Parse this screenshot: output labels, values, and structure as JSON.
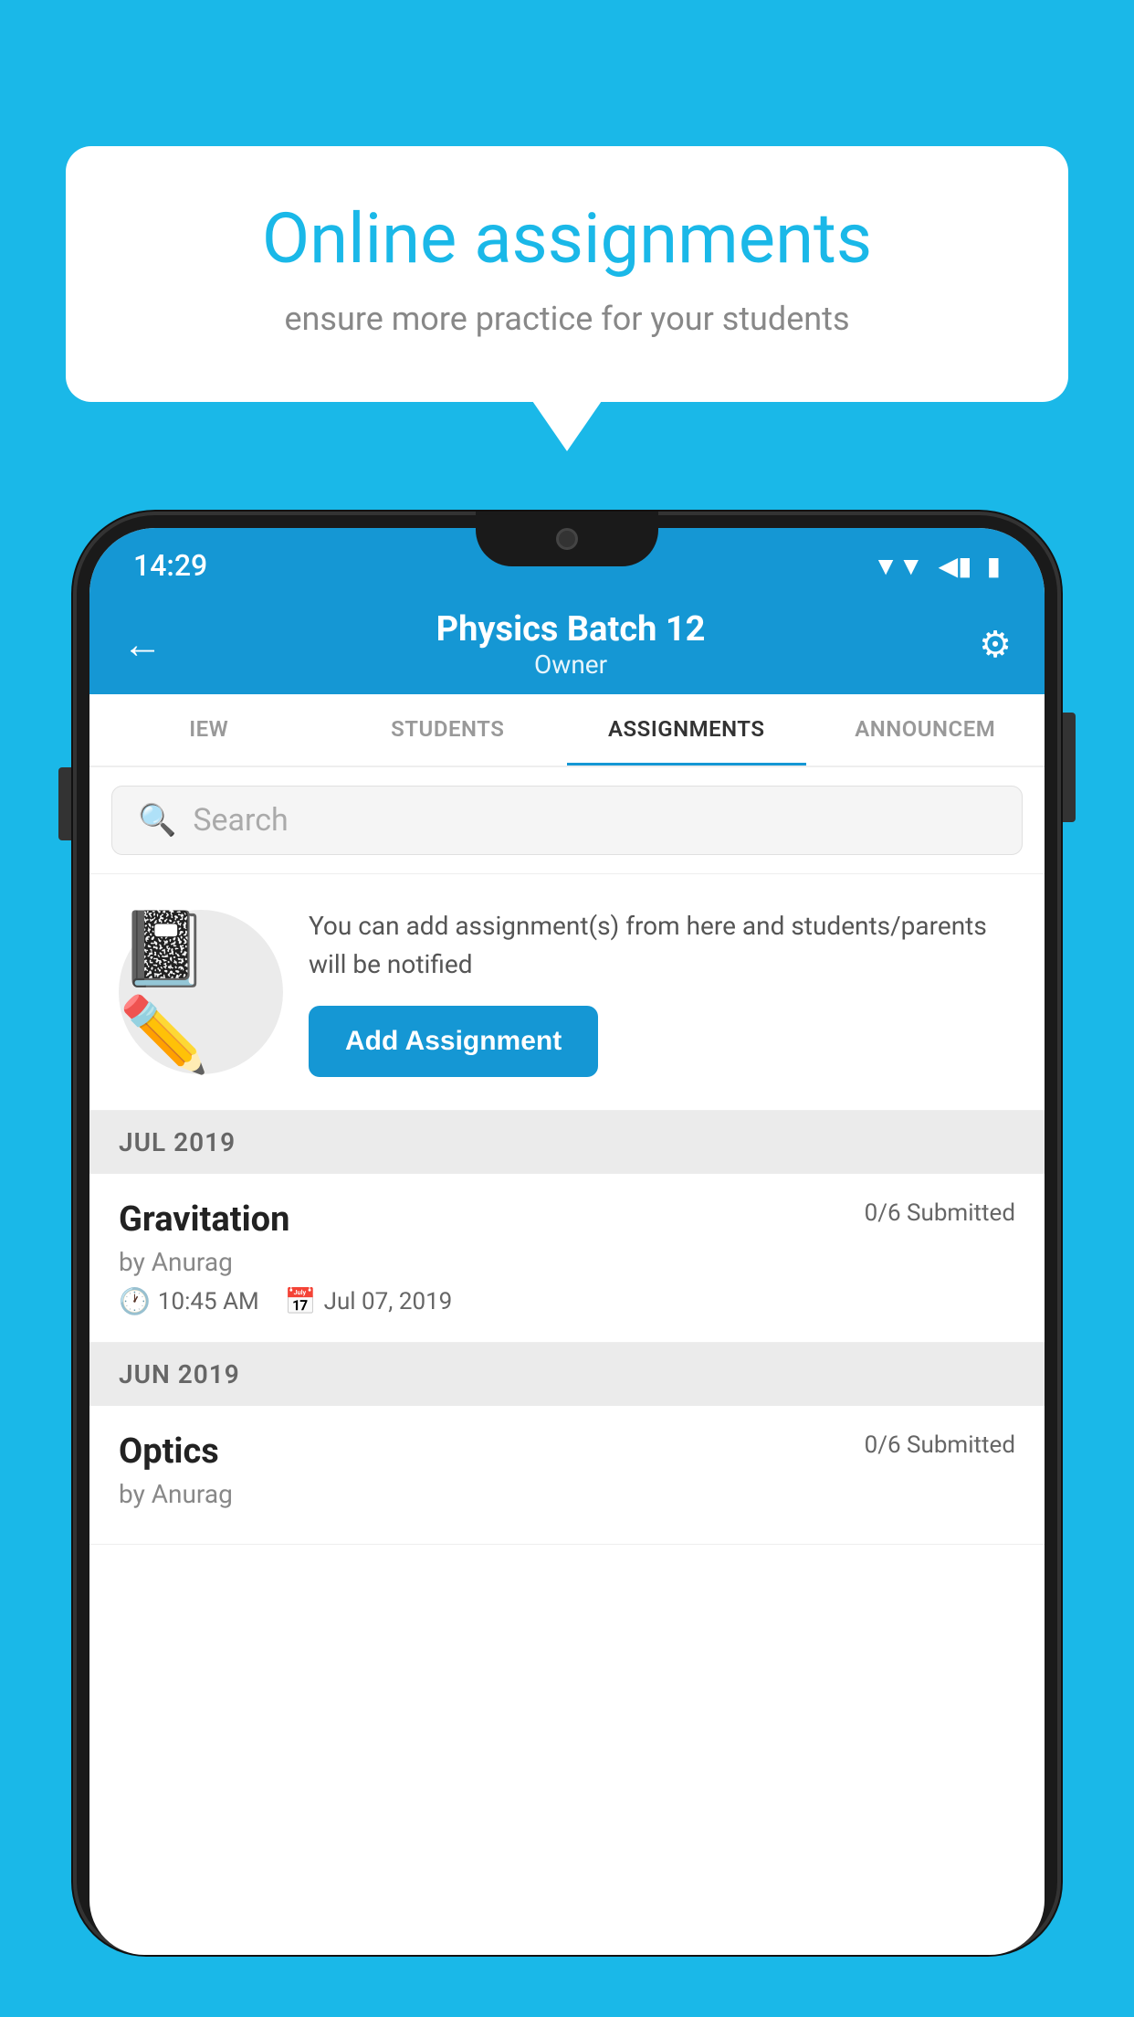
{
  "background": {
    "color": "#1ab8e8"
  },
  "speech_bubble": {
    "title": "Online assignments",
    "subtitle": "ensure more practice for your students"
  },
  "status_bar": {
    "time": "14:29",
    "wifi_icon": "▼",
    "signal_icon": "◀",
    "battery_icon": "▮"
  },
  "app_header": {
    "back_icon": "←",
    "title": "Physics Batch 12",
    "subtitle": "Owner",
    "settings_icon": "⚙"
  },
  "tabs": [
    {
      "label": "IEW",
      "active": false
    },
    {
      "label": "STUDENTS",
      "active": false
    },
    {
      "label": "ASSIGNMENTS",
      "active": true
    },
    {
      "label": "ANNOUNCEM",
      "active": false
    }
  ],
  "search": {
    "placeholder": "Search",
    "search_icon": "🔍"
  },
  "promo": {
    "description": "You can add assignment(s) from here and students/parents will be notified",
    "add_button_label": "Add Assignment",
    "icon": "📓"
  },
  "sections": [
    {
      "month_label": "JUL 2019",
      "assignments": [
        {
          "name": "Gravitation",
          "submitted": "0/6 Submitted",
          "by": "by Anurag",
          "time": "10:45 AM",
          "date": "Jul 07, 2019"
        }
      ]
    },
    {
      "month_label": "JUN 2019",
      "assignments": [
        {
          "name": "Optics",
          "submitted": "0/6 Submitted",
          "by": "by Anurag",
          "time": "",
          "date": ""
        }
      ]
    }
  ]
}
